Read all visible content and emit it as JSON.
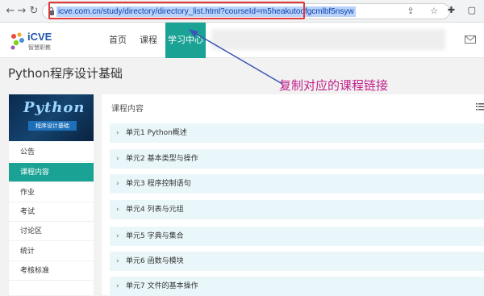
{
  "browser": {
    "back_icon": "←",
    "forward_icon": "→",
    "refresh_icon": "↻",
    "url": "icve.com.cn/study/directory/directory_list.html?courseId=m5heakutoofgcmlbf5nsyw",
    "addr_icons": "⇪ ☆",
    "ext_icons": "✚ ▢"
  },
  "site": {
    "logo_text": "iCVE",
    "logo_sub": "智慧职教",
    "nav": [
      {
        "label": "首页"
      },
      {
        "label": "课程"
      },
      {
        "label": "学习中心"
      }
    ]
  },
  "course": {
    "title": "Python程序设计基础",
    "cover_title": "Python",
    "cover_sub": "程序设计基础"
  },
  "annotation": {
    "text": "复制对应的课程链接",
    "color": "#c0208a"
  },
  "sidebar": {
    "items": [
      {
        "label": "公告"
      },
      {
        "label": "课程内容"
      },
      {
        "label": "作业"
      },
      {
        "label": "考试"
      },
      {
        "label": "讨论区"
      },
      {
        "label": "统计"
      },
      {
        "label": "考核标准"
      }
    ]
  },
  "main": {
    "heading": "课程内容",
    "units": [
      {
        "label": "单元1 Python概述"
      },
      {
        "label": "单元2 基本类型与操作"
      },
      {
        "label": "单元3 程序控制语句"
      },
      {
        "label": "单元4 列表与元组"
      },
      {
        "label": "单元5 字典与集合"
      },
      {
        "label": "单元6 函数与模块"
      },
      {
        "label": "单元7 文件的基本操作"
      }
    ]
  },
  "colors": {
    "accent": "#1aa294",
    "highlight_box": "#e23a3a",
    "arrow": "#3d56b8"
  }
}
